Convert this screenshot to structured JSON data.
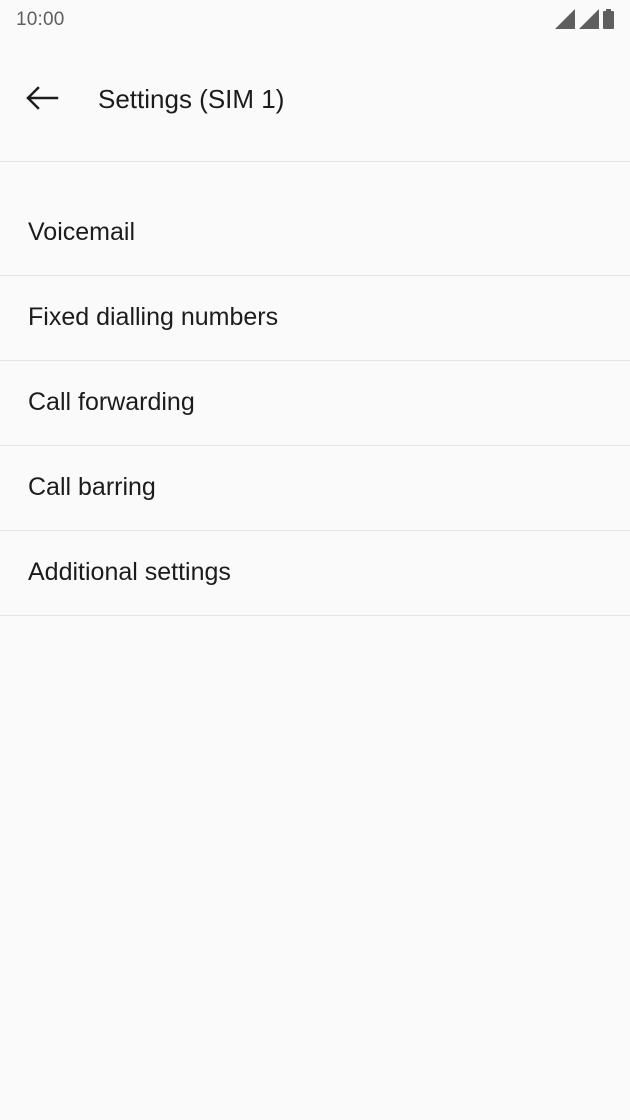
{
  "status_bar": {
    "time": "10:00",
    "icons": [
      "signal-sim1-icon",
      "signal-sim2-icon",
      "battery-icon"
    ]
  },
  "toolbar": {
    "back_icon": "arrow-back-icon",
    "title": "Settings (SIM 1)"
  },
  "settings": {
    "items": [
      {
        "label": "Voicemail"
      },
      {
        "label": "Fixed dialling numbers"
      },
      {
        "label": "Call forwarding"
      },
      {
        "label": "Call barring"
      },
      {
        "label": "Additional settings"
      }
    ]
  },
  "colors": {
    "background": "#fafafa",
    "text_primary": "#1c1c1c",
    "text_secondary": "#5f5f5f",
    "divider": "#e4e4e4"
  }
}
